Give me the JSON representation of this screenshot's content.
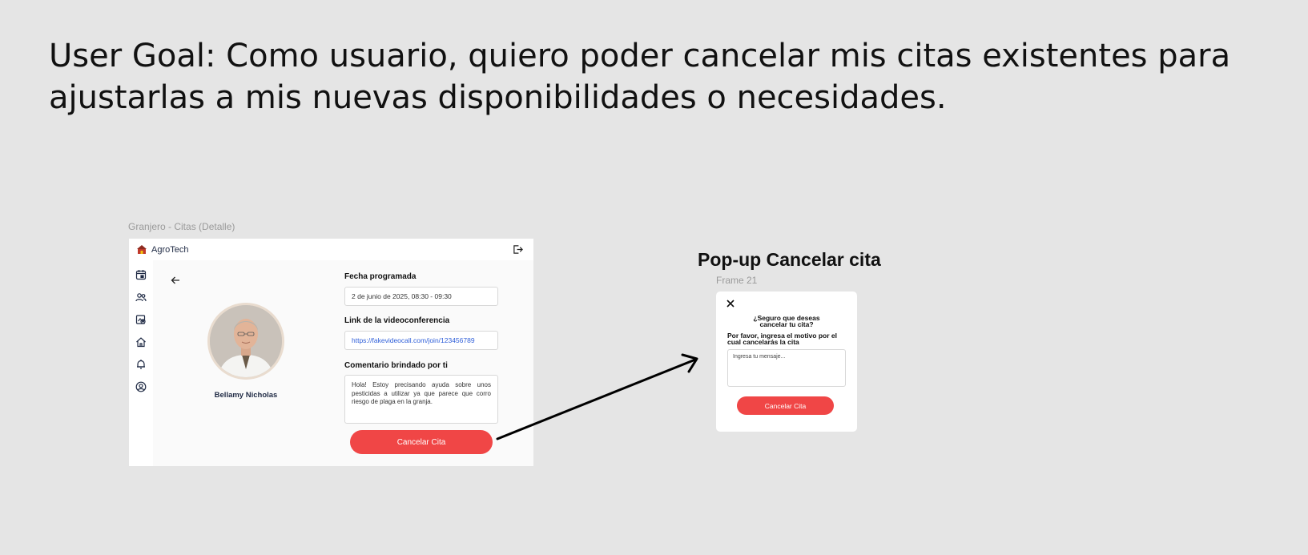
{
  "user_goal": "User Goal: Como usuario, quiero poder cancelar mis citas existentes para ajustarlas a mis nuevas disponibilidades o necesidades.",
  "main_frame": {
    "frame_label": "Granjero - Citas (Detalle)",
    "app_name": "AgroTech",
    "sidebar_icons": [
      "calendar-icon",
      "users-icon",
      "image-user-icon",
      "home-icon",
      "bell-icon",
      "user-circle-icon"
    ],
    "doctor_name": "Bellamy Nicholas",
    "date_label": "Fecha programada",
    "date_value": "2 de junio de 2025, 08:30 - 09:30",
    "link_label": "Link de la videoconferencia",
    "link_value": "https://fakevideocall.com/join/123456789",
    "comment_label": "Comentario brindado por ti",
    "comment_value": "Hola! Estoy precisando ayuda sobre unos pesticidas a utilizar ya que parece que corro riesgo de plaga en la granja.",
    "cancel_button": "Cancelar Cita"
  },
  "popup": {
    "section_title": "Pop-up Cancelar cita",
    "frame_label": "Frame 21",
    "question": "¿Seguro que deseas cancelar tu cita?",
    "prompt": "Por favor, ingresa el motivo por el cual cancelarás la cita",
    "input_placeholder": "Ingresa tu mensaje...",
    "cancel_button": "Cancelar Cita"
  },
  "colors": {
    "accent": "#f04646",
    "link": "#2f5fd9",
    "canvas": "#e5e5e5"
  }
}
